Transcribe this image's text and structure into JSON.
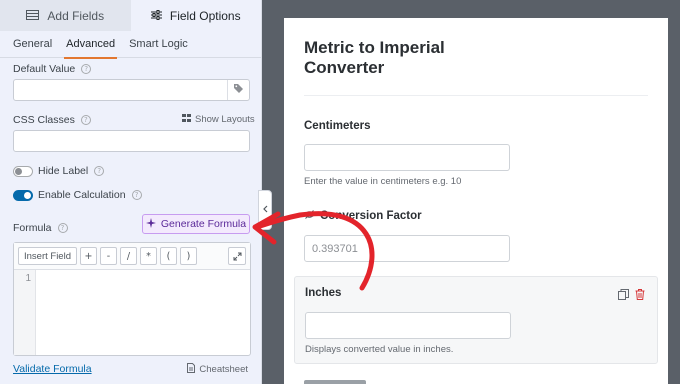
{
  "panel": {
    "tabs": [
      {
        "label": "Add Fields",
        "icon": "table-icon",
        "active": false
      },
      {
        "label": "Field Options",
        "icon": "sliders-icon",
        "active": true
      }
    ],
    "subtabs": [
      "General",
      "Advanced",
      "Smart Logic"
    ],
    "active_subtab": "Advanced",
    "default_value_label": "Default Value",
    "default_value": "",
    "css_classes_label": "CSS Classes",
    "css_classes_value": "",
    "show_layouts_label": "Show Layouts",
    "hide_label": {
      "label": "Hide Label",
      "on": false
    },
    "enable_calculation": {
      "label": "Enable Calculation",
      "on": true
    },
    "formula_label": "Formula",
    "generate_formula_label": "Generate Formula",
    "editor": {
      "insert_field_label": "Insert Field",
      "operators": [
        "+",
        "-",
        "/",
        "*",
        "(",
        ")"
      ],
      "line_number": "1",
      "content": ""
    },
    "validate_formula_label": "Validate Formula",
    "cheatsheet_label": "Cheatsheet"
  },
  "preview": {
    "form_title": "Metric to Imperial Converter",
    "fields": [
      {
        "label": "Centimeters",
        "value": "",
        "description": "Enter the value in centimeters e.g. 10"
      },
      {
        "label": "Conversion Factor",
        "hidden_icon": "eye-slash-icon",
        "value": "0.393701",
        "description": ""
      },
      {
        "label": "Inches",
        "value": "",
        "description": "Displays converted value in inches."
      }
    ]
  },
  "colors": {
    "accent_orange": "#e27730",
    "toggle_on": "#056aab",
    "generate_purple": "#c79cf0",
    "arrow_red": "#e3242b",
    "delete_red": "#d63638"
  }
}
